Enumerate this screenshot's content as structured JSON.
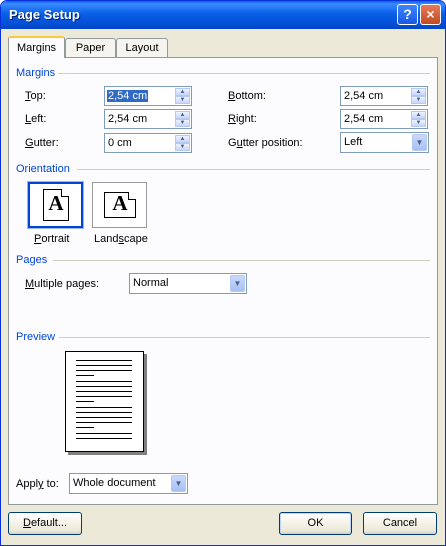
{
  "window": {
    "title": "Page Setup",
    "help_glyph": "?",
    "close_glyph": "×"
  },
  "tabs": [
    {
      "label": "Margins"
    },
    {
      "label": "Paper"
    },
    {
      "label": "Layout"
    }
  ],
  "margins_group": {
    "label": "Margins",
    "top": {
      "mnemonic": "T",
      "rest": "op:",
      "value": "2,54 cm"
    },
    "left": {
      "mnemonic": "L",
      "rest": "eft:",
      "value": "2,54 cm"
    },
    "gutter": {
      "mnemonic": "G",
      "rest": "utter:",
      "value": "0 cm"
    },
    "bottom": {
      "mnemonic": "B",
      "rest": "ottom:",
      "value": "2,54 cm"
    },
    "right": {
      "mnemonic": "R",
      "rest": "ight:",
      "value": "2,54 cm"
    },
    "gutter_position": {
      "pre": "G",
      "mnemonic": "u",
      "rest": "tter position:",
      "value": "Left"
    }
  },
  "orientation": {
    "label": "Orientation",
    "portrait": {
      "mnemonic": "P",
      "rest": "ortrait",
      "glyph": "A",
      "selected": true
    },
    "landscape": {
      "pre": "Land",
      "mnemonic": "s",
      "rest": "cape",
      "glyph": "A",
      "selected": false
    }
  },
  "pages": {
    "label": "Pages",
    "multiple_pages": {
      "mnemonic": "M",
      "rest": "ultiple pages:",
      "value": "Normal"
    }
  },
  "preview": {
    "label": "Preview"
  },
  "apply_to": {
    "pre": "Appl",
    "mnemonic": "y",
    "rest": " to:",
    "value": "Whole document"
  },
  "buttons": {
    "default": {
      "mnemonic": "D",
      "rest": "efault..."
    },
    "ok": "OK",
    "cancel": "Cancel"
  },
  "colors": {
    "titlebar": "#0a5fe8",
    "group_label": "#0046d5",
    "dialog_bg": "#ece9d8",
    "selection": "#316ac5"
  },
  "icons": {
    "spin": "spin-arrows-icon",
    "dropdown": "chevron-down-icon",
    "orientation": "page-icon"
  }
}
